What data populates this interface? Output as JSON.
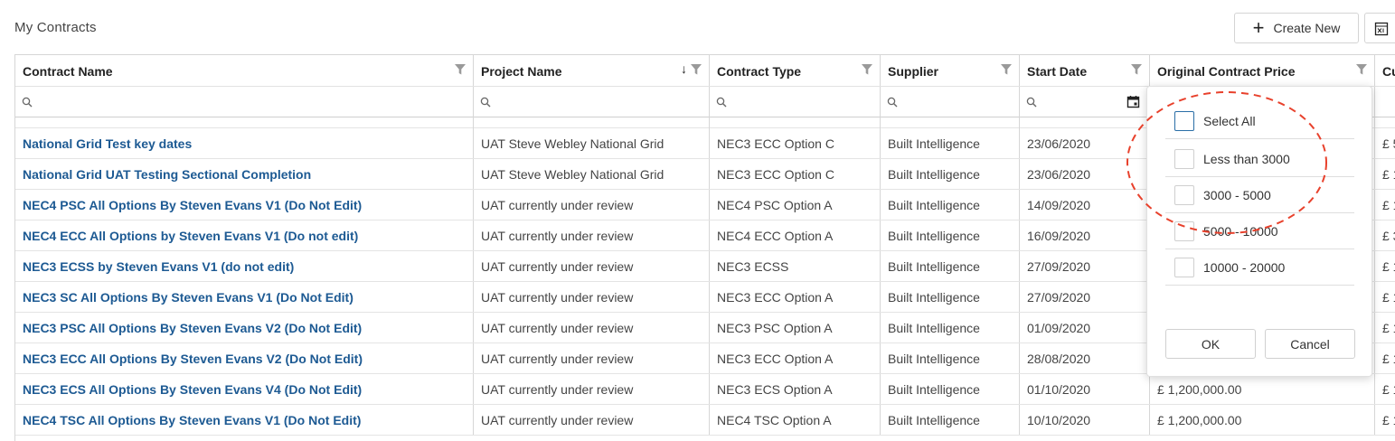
{
  "header": {
    "title": "My Contracts",
    "create_new_label": "Create New"
  },
  "table": {
    "columns": [
      {
        "label": "Contract Name"
      },
      {
        "label": "Project Name",
        "sort": "descending"
      },
      {
        "label": "Contract Type"
      },
      {
        "label": "Supplier"
      },
      {
        "label": "Start Date"
      },
      {
        "label": "Original Contract Price"
      },
      {
        "label": "Cu"
      }
    ],
    "rows": [
      {
        "contract_name": "National Grid Test key dates",
        "project_name": "UAT Steve Webley National Grid",
        "contract_type": "NEC3 ECC Option C",
        "supplier": "Built Intelligence",
        "start_date": "23/06/2020",
        "price": "",
        "cu": "£ 5"
      },
      {
        "contract_name": "National Grid UAT Testing Sectional Completion",
        "project_name": "UAT Steve Webley National Grid",
        "contract_type": "NEC3 ECC Option C",
        "supplier": "Built Intelligence",
        "start_date": "23/06/2020",
        "price": "",
        "cu": "£ 1"
      },
      {
        "contract_name": "NEC4 PSC All Options By Steven Evans V1 (Do Not Edit)",
        "project_name": "UAT currently under review",
        "contract_type": "NEC4 PSC Option A",
        "supplier": "Built Intelligence",
        "start_date": "14/09/2020",
        "price": "",
        "cu": "£ 1"
      },
      {
        "contract_name": "NEC4 ECC All Options by Steven Evans V1 (Do not edit)",
        "project_name": "UAT currently under review",
        "contract_type": "NEC4 ECC Option A",
        "supplier": "Built Intelligence",
        "start_date": "16/09/2020",
        "price": "",
        "cu": "£ 3"
      },
      {
        "contract_name": "NEC3 ECSS by Steven Evans V1 (do not edit)",
        "project_name": "UAT currently under review",
        "contract_type": "NEC3 ECSS",
        "supplier": "Built Intelligence",
        "start_date": "27/09/2020",
        "price": "",
        "cu": "£ 1"
      },
      {
        "contract_name": "NEC3 SC All Options By Steven Evans V1 (Do Not Edit)",
        "project_name": "UAT currently under review",
        "contract_type": "NEC3 ECC Option A",
        "supplier": "Built Intelligence",
        "start_date": "27/09/2020",
        "price": "",
        "cu": "£ 1"
      },
      {
        "contract_name": "NEC3 PSC All Options By Steven Evans V2 (Do Not Edit)",
        "project_name": "UAT currently under review",
        "contract_type": "NEC3 PSC Option A",
        "supplier": "Built Intelligence",
        "start_date": "01/09/2020",
        "price": "",
        "cu": "£ 1"
      },
      {
        "contract_name": "NEC3 ECC All Options By Steven Evans V2 (Do Not Edit)",
        "project_name": "UAT currently under review",
        "contract_type": "NEC3 ECC Option A",
        "supplier": "Built Intelligence",
        "start_date": "28/08/2020",
        "price": "",
        "cu": "£ 1"
      },
      {
        "contract_name": "NEC3 ECS All Options By Steven Evans V4 (Do Not Edit)",
        "project_name": "UAT currently under review",
        "contract_type": "NEC3 ECS Option A",
        "supplier": "Built Intelligence",
        "start_date": "01/10/2020",
        "price": "£ 1,200,000.00",
        "cu": "£ 1"
      },
      {
        "contract_name": "NEC4 TSC All Options By Steven Evans V1 (Do Not Edit)",
        "project_name": "UAT currently under review",
        "contract_type": "NEC4 TSC Option A",
        "supplier": "Built Intelligence",
        "start_date": "10/10/2020",
        "price": "£ 1,200,000.00",
        "cu": "£ 1"
      }
    ]
  },
  "filter_dropdown": {
    "options": [
      "Select All",
      "Less than 3000",
      "3000 - 5000",
      "5000 - 10000",
      "10000 - 20000"
    ],
    "ok_label": "OK",
    "cancel_label": "Cancel"
  },
  "icons": {
    "create": "plus-icon",
    "export": "excel-export-icon",
    "filter": "funnel-icon",
    "search": "search-icon",
    "calendar": "calendar-icon",
    "sort": "sort-down-arrow-icon"
  },
  "colors": {
    "link": "#1d5a93",
    "annotation": "#e8412c"
  }
}
